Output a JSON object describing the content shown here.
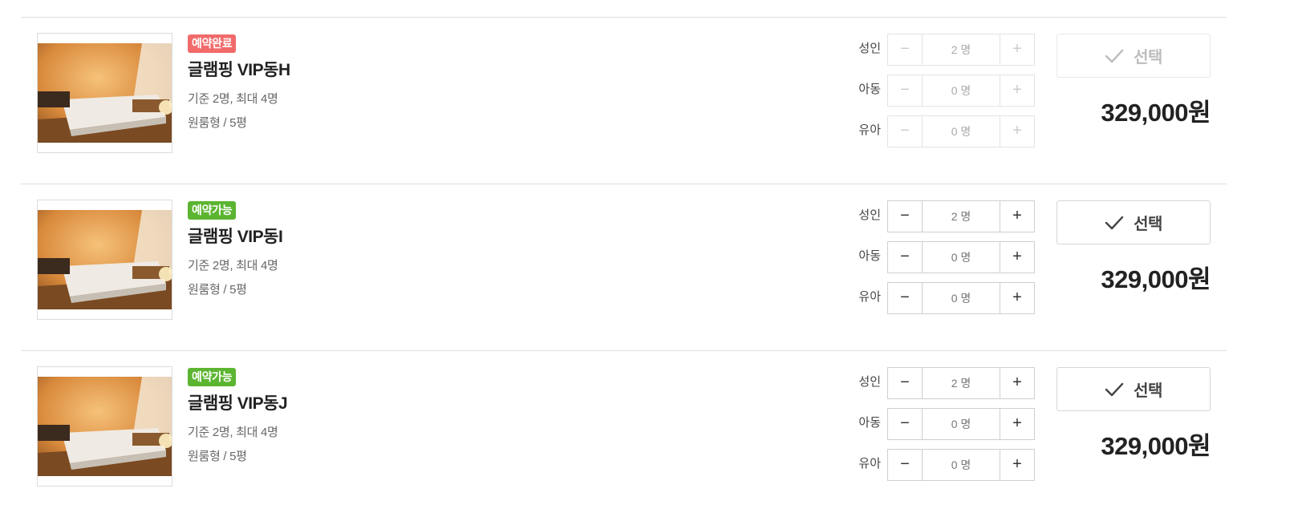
{
  "counter_unit": "명",
  "rooms": [
    {
      "status": "예약완료",
      "status_color": "#f26a6a",
      "name": "글램핑 VIP동H",
      "capacity": "기준 2명, 최대 4명",
      "type": "원룸형 / 5평",
      "guests": [
        {
          "label": "성인",
          "value": "2 명"
        },
        {
          "label": "아동",
          "value": "0 명"
        },
        {
          "label": "유아",
          "value": "0 명"
        }
      ],
      "select_label": "선택",
      "price": "329,000원",
      "available": false
    },
    {
      "status": "예약가능",
      "status_color": "#5cb531",
      "name": "글램핑 VIP동I",
      "capacity": "기준 2명, 최대 4명",
      "type": "원룸형 / 5평",
      "guests": [
        {
          "label": "성인",
          "value": "2 명"
        },
        {
          "label": "아동",
          "value": "0 명"
        },
        {
          "label": "유아",
          "value": "0 명"
        }
      ],
      "select_label": "선택",
      "price": "329,000원",
      "available": true
    },
    {
      "status": "예약가능",
      "status_color": "#5cb531",
      "name": "글램핑 VIP동J",
      "capacity": "기준 2명, 최대 4명",
      "type": "원룸형 / 5평",
      "guests": [
        {
          "label": "성인",
          "value": "2 명"
        },
        {
          "label": "아동",
          "value": "0 명"
        },
        {
          "label": "유아",
          "value": "0 명"
        }
      ],
      "select_label": "선택",
      "price": "329,000원",
      "available": true
    }
  ],
  "icons": {
    "minus": "minus-icon",
    "plus": "plus-icon",
    "check": "checkmark-icon"
  }
}
